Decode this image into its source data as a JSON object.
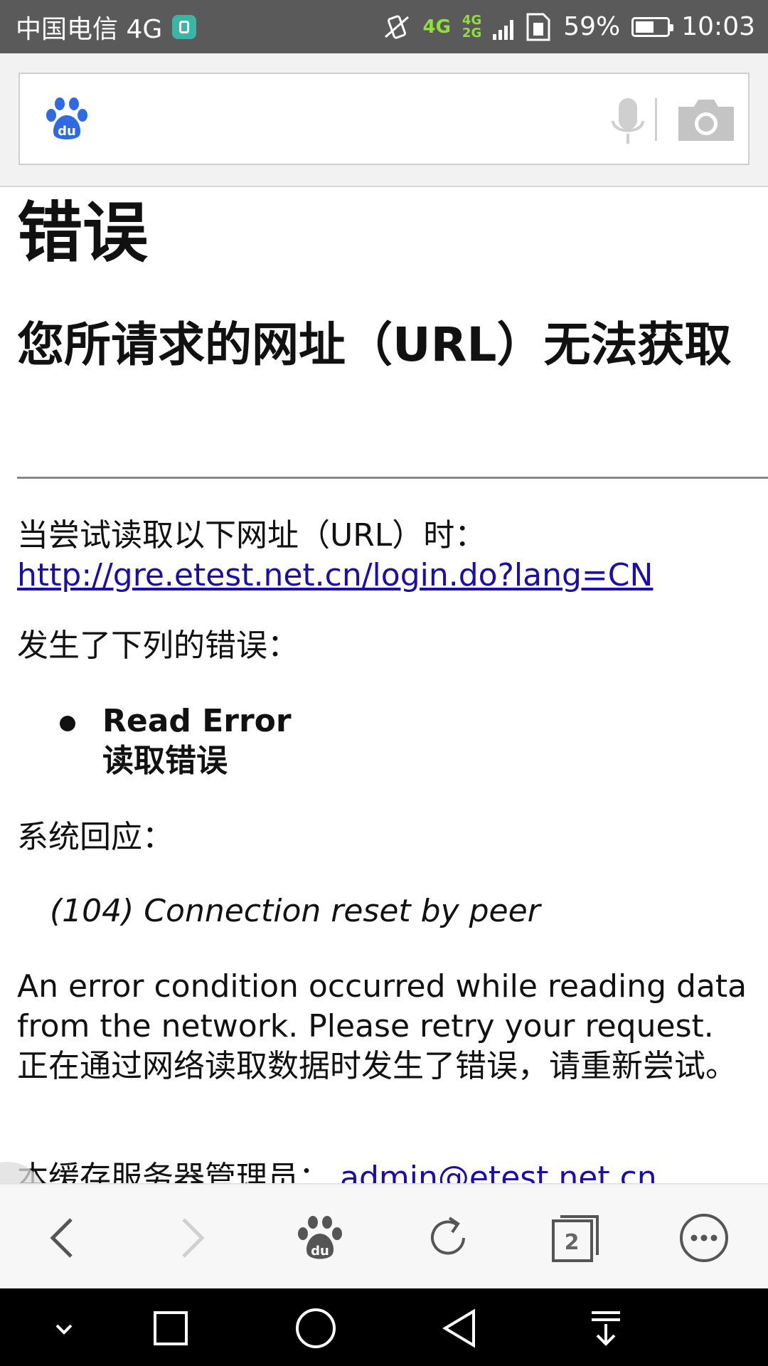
{
  "status_bar": {
    "carrier": "中国电信 4G",
    "network_top": "4G",
    "network_small_top": "4G",
    "network_small_bottom": "2G",
    "battery_percent": "59%",
    "battery_level": 0.59,
    "time": "10:03"
  },
  "page": {
    "title": "错误",
    "subtitle": "您所请求的网址（URL）无法获取",
    "url_prefix": "当尝试读取以下网址（URL）时：",
    "url_link": "http://gre.etest.net.cn/login.do?lang=CN",
    "occurred": "发生了下列的错误：",
    "error_en": "Read Error",
    "error_cn": "读取错误",
    "system_response": "系统回应：",
    "error_code": "(104) Connection reset by peer",
    "description_en": "An error condition occurred while reading data from the network. Please retry your request.",
    "description_cn": "正在通过网络读取数据时发生了错误，请重新尝试。",
    "admin_label": "本缓存服务器管理员：",
    "admin_email": "admin@etest.net.cn"
  },
  "toolbar": {
    "tabs_count": "2"
  },
  "icons": {
    "search_logo": "baidu-paw-icon",
    "voice": "microphone-icon",
    "camera": "camera-icon",
    "back": "chevron-left-icon",
    "forward": "chevron-right-icon",
    "home": "baidu-paw-icon",
    "refresh": "refresh-icon",
    "tabs": "tabs-icon",
    "menu": "more-icon"
  },
  "colors": {
    "link": "#1a0dab",
    "baidu_blue": "#2f6be0",
    "status_bar": "#5a5a5a"
  }
}
